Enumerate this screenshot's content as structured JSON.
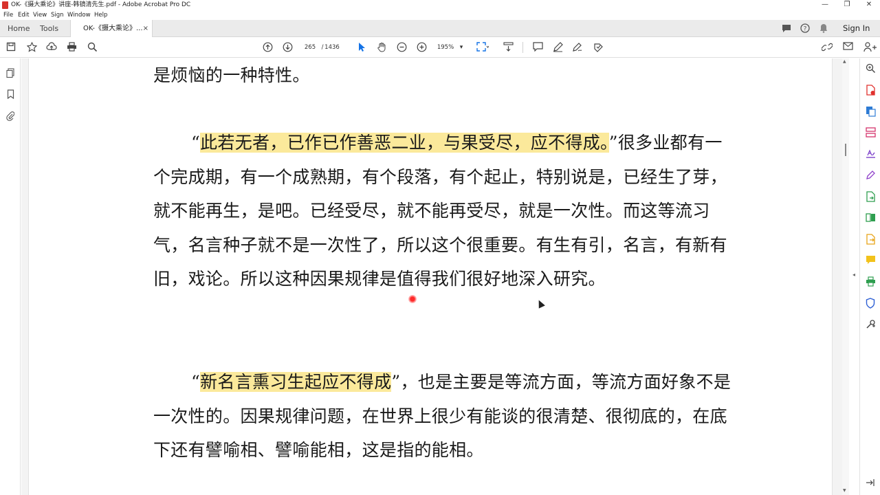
{
  "window": {
    "title": "OK-《摄大乘论》讲座-韩镜清先生.pdf - Adobe Acrobat Pro DC",
    "minimize": "—",
    "restore": "❐",
    "close": "✕"
  },
  "menu": [
    "File",
    "Edit",
    "View",
    "Sign",
    "Window",
    "Help"
  ],
  "tabs": {
    "home": "Home",
    "tools": "Tools",
    "document": "OK-《摄大乘论》...",
    "close": "×",
    "signin": "Sign In"
  },
  "toolbar": {
    "page_current": "265",
    "page_separator": "/",
    "page_total": "1436",
    "zoom": "195%",
    "dropdown": "▾"
  },
  "colors": {
    "highlight": "#fbe99b",
    "accent": "#1473e6"
  },
  "document": {
    "p0": "是烦恼的一种特性。",
    "p1_open": "“",
    "p1_hl": "此若无者，已作已作善恶二业，与果受尽，应不得成。",
    "p1_rest": "”很多业都有一个完成期，有一个成熟期，有个段落，有个起止，特别说是，已经生了芽，就不能再生，是吧。已经受尽，就不能再受尽，就是一次性。而这等流习气，名言种子就不是一次性了，所以这个很重要。有生有引，名言，有新有旧，戏论。所以这种因果规律是值得我们很好地深入研究。",
    "p2_open": "“",
    "p2_hl": "新名言熏习生起应不得成",
    "p2_rest": "”，也是主要是等流方面，等流方面好象不是一次性的。因果规律问题，在世界上很少有能谈的很清楚、很彻底的，在底下还有譬喻相、譬喻能相，这是指的能相。"
  },
  "icons": {
    "toolbar": [
      "save-icon",
      "bookmark-star-icon",
      "upload-icon",
      "print-icon",
      "search-icon",
      "page-up-icon",
      "page-down-icon",
      "select-cursor-icon",
      "hand-icon",
      "zoom-out-icon",
      "zoom-in-icon",
      "fit-page-icon",
      "scroll-mode-icon",
      "comment-icon",
      "pen-icon",
      "sign-icon",
      "stamp-icon",
      "link-icon",
      "mail-icon",
      "more-icon",
      "user-icon"
    ],
    "right": [
      "search-zoom-icon",
      "export-pdf-icon",
      "create-pdf-icon",
      "organize-icon",
      "edit-text-icon",
      "fill-sign-icon",
      "export-icon",
      "compare-icon",
      "send-icon",
      "comment-icon",
      "print-production-icon",
      "protect-icon",
      "more-tools-icon",
      "expand-icon"
    ]
  }
}
